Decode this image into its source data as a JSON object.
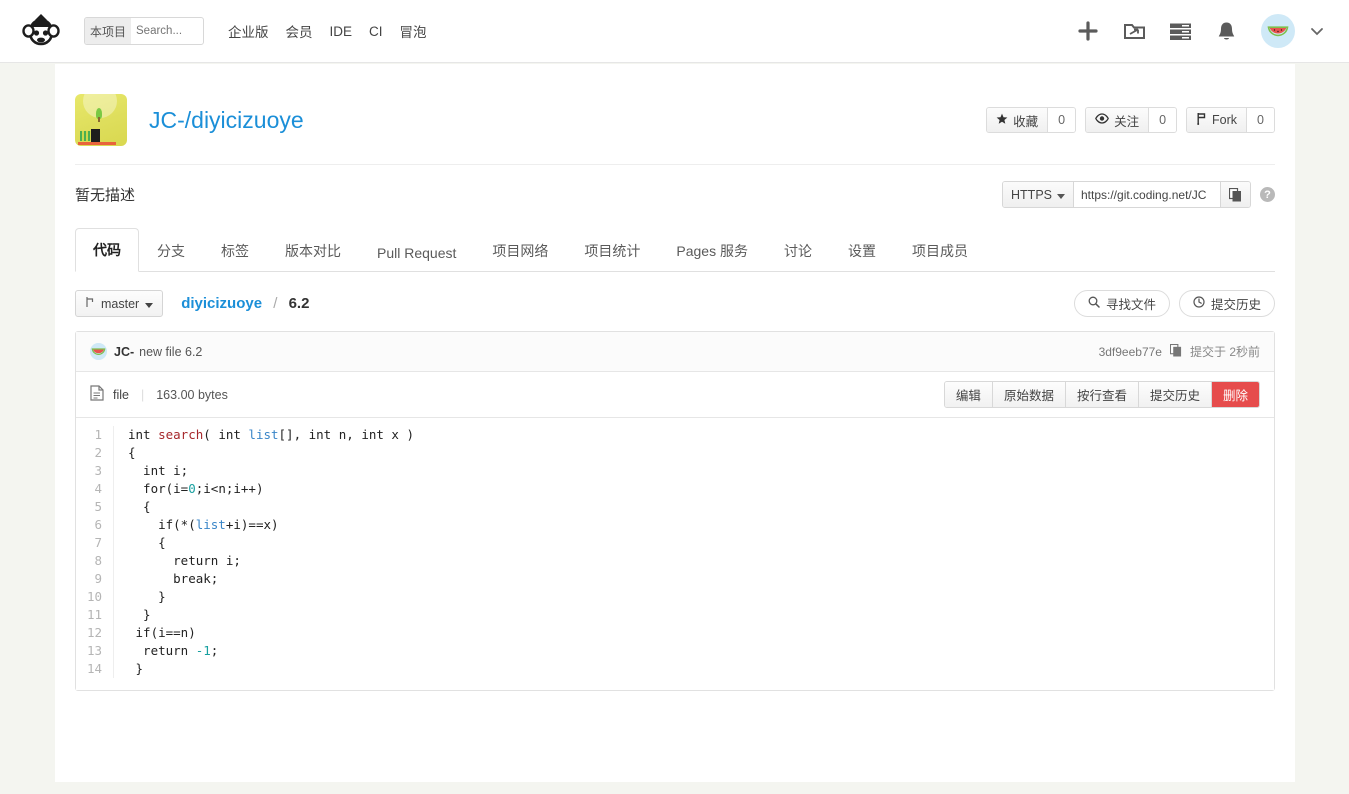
{
  "topnav": {
    "logo_icon": "coding-monkey-logo",
    "search": {
      "scope": "本项目",
      "placeholder": "Search...",
      "value": ""
    },
    "links": [
      {
        "label": "企业版",
        "name": "nav-enterprise"
      },
      {
        "label": "会员",
        "name": "nav-member"
      },
      {
        "label": "IDE",
        "name": "nav-ide"
      },
      {
        "label": "CI",
        "name": "nav-ci"
      },
      {
        "label": "冒泡",
        "name": "nav-bubble"
      }
    ],
    "icons": [
      {
        "name": "plus-icon"
      },
      {
        "name": "project-folder-icon"
      },
      {
        "name": "task-list-icon"
      },
      {
        "name": "bell-icon"
      }
    ],
    "avatar_icon": "watermelon-avatar",
    "chevron_icon": "chevron-down-icon"
  },
  "repo": {
    "avatar_icon": "repo-avatar-image",
    "title": "JC-/diyicizuoye",
    "description": "暂无描述",
    "stats": [
      {
        "name": "star",
        "icon": "star-icon",
        "label": "收藏",
        "count": "0"
      },
      {
        "name": "watch",
        "icon": "eye-icon",
        "label": "关注",
        "count": "0"
      },
      {
        "name": "fork",
        "icon": "fork-icon",
        "label": "Fork",
        "count": "0"
      }
    ],
    "clone": {
      "protocol": "HTTPS",
      "url": "https://git.coding.net/JC",
      "copy_icon": "copy-icon",
      "help_icon": "question-icon"
    }
  },
  "tabs": [
    {
      "label": "代码",
      "active": true
    },
    {
      "label": "分支",
      "active": false
    },
    {
      "label": "标签",
      "active": false
    },
    {
      "label": "版本对比",
      "active": false
    },
    {
      "label": "Pull Request",
      "active": false
    },
    {
      "label": "项目网络",
      "active": false
    },
    {
      "label": "项目统计",
      "active": false
    },
    {
      "label": "Pages 服务",
      "active": false
    },
    {
      "label": "讨论",
      "active": false
    },
    {
      "label": "设置",
      "active": false
    },
    {
      "label": "项目成员",
      "active": false
    }
  ],
  "branch_bar": {
    "branch": "master",
    "branch_icon": "branch-icon",
    "crumb_root": "diyicizuoye",
    "crumb_sep": "/",
    "crumb_current": "6.2",
    "find_file": {
      "label": "寻找文件",
      "icon": "search-icon"
    },
    "commit_history": {
      "label": "提交历史",
      "icon": "clock-icon"
    }
  },
  "commit": {
    "avatar_icon": "watermelon-avatar",
    "author": "JC-",
    "message": "new file 6.2",
    "sha": "3df9eeb77e",
    "copy_icon": "copy-icon",
    "time": "提交于 2秒前"
  },
  "file": {
    "icon": "file-icon",
    "name": "file",
    "size": "163.00 bytes",
    "actions": [
      {
        "label": "编辑",
        "danger": false
      },
      {
        "label": "原始数据",
        "danger": false
      },
      {
        "label": "按行查看",
        "danger": false
      },
      {
        "label": "提交历史",
        "danger": false
      },
      {
        "label": "删除",
        "danger": true
      }
    ]
  },
  "code": {
    "language": "c",
    "lines": [
      {
        "n": 1,
        "tokens": [
          {
            "t": "int search( int ",
            "c": "kw"
          },
          {
            "t": "",
            "c": ""
          }
        ]
      },
      {
        "n": 2,
        "tokens": []
      }
    ],
    "raw_lines": [
      "int search( int list[], int n, int x )",
      "{",
      "  int i;",
      "  for(i=0;i<n;i++)",
      "  {",
      "    if(*(list+i)==x)",
      "    {",
      "      return i;",
      "      break;",
      "    }",
      "  }",
      " if(i==n)",
      "  return -1;",
      " }"
    ],
    "line_numbers": [
      "1",
      "2",
      "3",
      "4",
      "5",
      "6",
      "7",
      "8",
      "9",
      "10",
      "11",
      "12",
      "13",
      "14"
    ]
  }
}
